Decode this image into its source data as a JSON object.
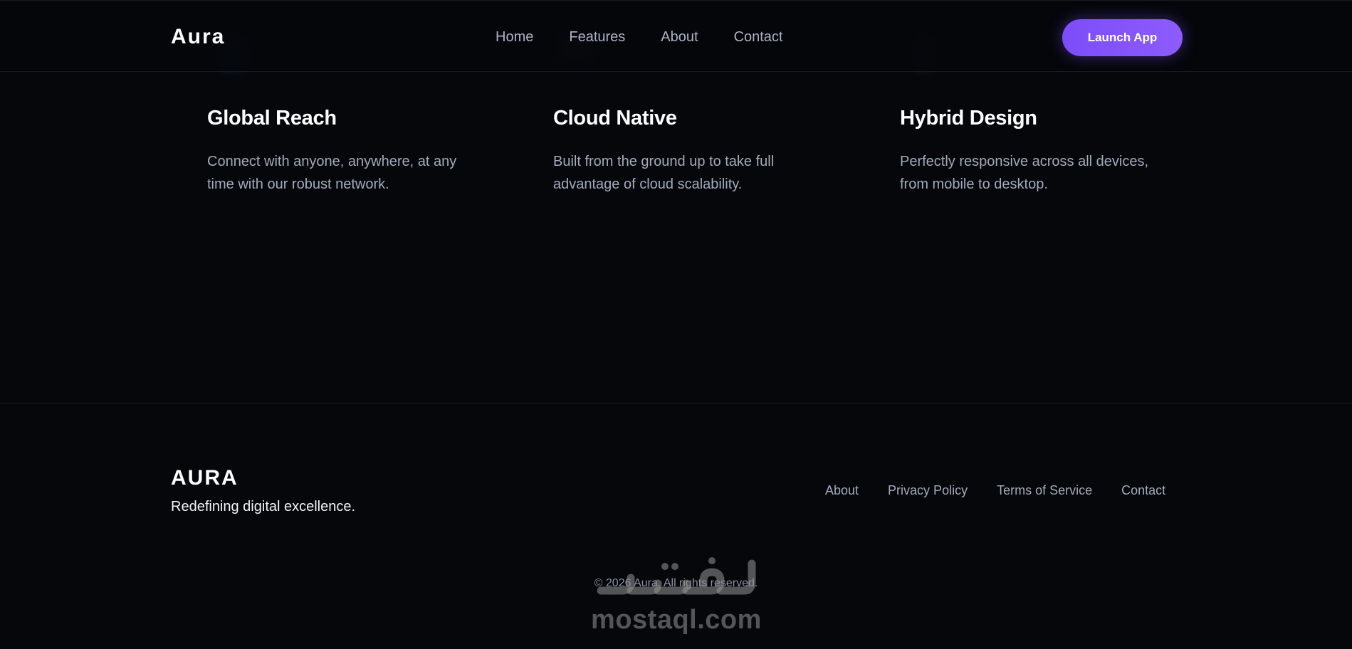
{
  "header": {
    "brand": "Aura",
    "nav": [
      "Home",
      "Features",
      "About",
      "Contact"
    ],
    "cta_label": "Launch App"
  },
  "features": [
    {
      "title": "Global Reach",
      "description": "Connect with anyone, anywhere, at any time with our robust network."
    },
    {
      "title": "Cloud Native",
      "description": "Built from the ground up to take full advantage of cloud scalability."
    },
    {
      "title": "Hybrid Design",
      "description": "Perfectly responsive across all devices, from mobile to desktop."
    }
  ],
  "footer": {
    "brand": "AURA",
    "tagline": "Redefining digital excellence.",
    "links": [
      "About",
      "Privacy Policy",
      "Terms of Service",
      "Contact"
    ],
    "copyright": "© 2026 Aura. All rights reserved."
  },
  "watermark": {
    "arabic": "مستقل",
    "latin": "mostaql.com"
  },
  "colors": {
    "background": "#05070b",
    "accent": "#7c4dfa",
    "muted_text": "#a2abbd"
  }
}
